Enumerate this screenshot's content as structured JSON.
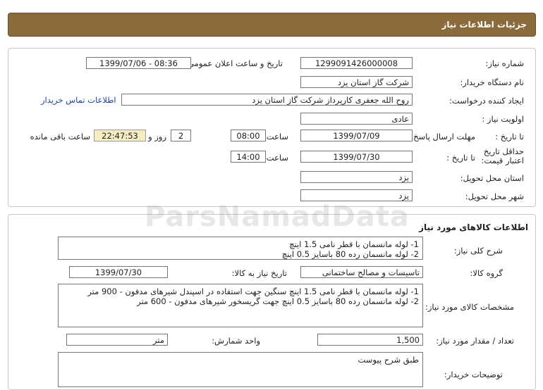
{
  "header": {
    "title": "جزئیات اطلاعات نیاز"
  },
  "info": {
    "need_number_label": "شماره نیاز:",
    "need_number": "1299091426000008",
    "announce_label": "تاریخ و ساعت اعلان عمومی:",
    "announce_value": "1399/07/06 - 08:36",
    "buyer_label": "نام دستگاه خریدار:",
    "buyer_value": "شرکت گاز استان یزد",
    "requester_label": "ایجاد کننده درخواست:",
    "requester_value": "روح الله جعفری کارپرداز  شرکت گاز استان یزد",
    "contact_link": "اطلاعات تماس خریدار",
    "priority_label": "اولویت نیاز :",
    "priority_value": "عادی",
    "deadline_label": "مهلت ارسال پاسخ:",
    "to_date_label": "تا تاریخ :",
    "deadline_date": "1399/07/09",
    "time_label": "ساعت",
    "deadline_time": "08:00",
    "days_value": "2",
    "days_label": "روز و",
    "remaining_time": "22:47:53",
    "remaining_label": "ساعت باقی مانده",
    "validity_label": "حداقل تاریخ اعتبار قیمت:",
    "validity_date": "1399/07/30",
    "validity_time": "14:00",
    "province_label": "استان محل تحویل:",
    "province_value": "یزد",
    "city_label": "شهر محل تحویل:",
    "city_value": "یزد"
  },
  "goods": {
    "section_title": "اطلاعات کالاهای مورد نیاز",
    "summary_label": "شرح کلی نیاز:",
    "summary_line1": "1- لوله مانسمان با قطر نامی 1.5 اینچ",
    "summary_line2": "2- لوله مانسمان رده 80 باسایز 0.5 اینچ",
    "group_label": "گروه کالا:",
    "group_value": "تاسیسات و مصالح ساختمانی",
    "need_date_label": "تاریخ نیاز به کالا:",
    "need_date": "1399/07/30",
    "spec_label": "مشخصات کالای مورد نیاز:",
    "spec_line1": "1- لوله مانسمان با قطر نامی 1.5 اینچ سنگین جهت استفاده در اسپندل شیرهای مدفون - 900 متر",
    "spec_line2": "2- لوله مانسمان رده 80 باسایز 0.5 اینچ جهت گریسخور شیرهای مدفون - 600 متر",
    "qty_label": "تعداد / مقدار مورد نیاز:",
    "qty_value": "1,500",
    "unit_label": "واحد شمارش:",
    "unit_value": "متر",
    "buyer_notes_label": "توضیحات خریدار:",
    "buyer_notes_value": "طبق شرح پیوست"
  },
  "watermark": "ParsNamadData"
}
